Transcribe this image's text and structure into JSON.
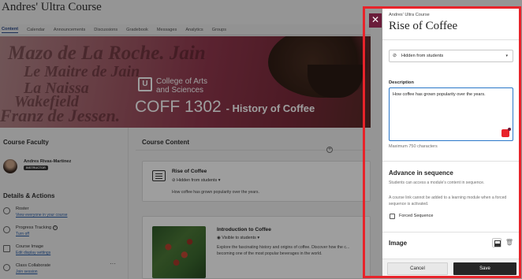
{
  "course": {
    "title": "Andres' Ultra Course",
    "nav": [
      "Content",
      "Calendar",
      "Announcements",
      "Discussions",
      "Gradebook",
      "Messages",
      "Analytics",
      "Groups"
    ],
    "banner": {
      "script_lines": [
        "Mazo de La Roche. Jain",
        "Le Maitre de Jain",
        "La Naissa",
        "Wakefield",
        "Franz de Jessen."
      ],
      "college": "College of Arts\nand Sciences",
      "code": "COFF 1302",
      "code_subtitle": "- History of Coffee"
    },
    "faculty": {
      "heading": "Course Faculty",
      "name": "Andres Rivas-Martinez",
      "role": "INSTRUCTOR"
    },
    "details": {
      "heading": "Details & Actions",
      "items": [
        {
          "title": "Roster",
          "link": "View everyone in your course"
        },
        {
          "title": "Progress Tracking",
          "link": "Turn off"
        },
        {
          "title": "Course Image",
          "link": "Edit display settings"
        },
        {
          "title": "Class Collaborate",
          "link": "Join session"
        }
      ]
    },
    "content": {
      "heading": "Course Content",
      "modules": [
        {
          "title": "Rise of Coffee",
          "visibility": "Hidden from students",
          "description": "How coffee has grown popularity over the years."
        },
        {
          "title": "Introduction to Coffee",
          "visibility": "Visible to students",
          "description": "Explore the fascinating history and origins of coffee. Discover how the c... becoming one of the most popular beverages in the world."
        }
      ]
    }
  },
  "panel": {
    "close_icon": "close-icon",
    "course_name": "Andres' Ultra Course",
    "title": "Rise of Coffee",
    "visibility": {
      "value": "Hidden from students",
      "icon": "eye-slash-icon"
    },
    "description": {
      "label": "Description",
      "value": "How coffee has grown popularity over the years.",
      "max_chars": "Maximum 750 characters"
    },
    "advance": {
      "heading": "Advance in sequence",
      "text1": "Students can access a module's content in sequence.",
      "text2": "A course link cannot be added to a learning module when a forced sequence is activated.",
      "checkbox_label": "Forced Sequence"
    },
    "image": {
      "heading": "Image"
    },
    "buttons": {
      "cancel": "Cancel",
      "save": "Save"
    },
    "colors": {
      "accent_red": "#e8232a",
      "brand": "#6a1c3a",
      "save_bg": "#262626"
    }
  }
}
